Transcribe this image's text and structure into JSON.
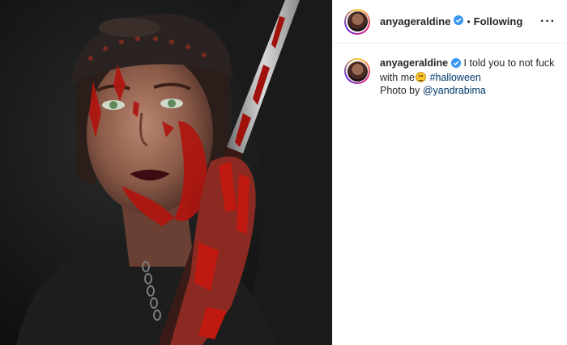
{
  "post": {
    "image_alt": "Portrait of a woman in bloody Halloween makeup wearing a studded cap, holding a blood-stained knife"
  },
  "header": {
    "username": "anyageraldine",
    "separator": "•",
    "follow_status": "Following",
    "more_label": "···"
  },
  "caption": {
    "username": "anyageraldine",
    "text_part1": " I told you to not fuck with me",
    "hashtag": "#halloween",
    "credit_prefix": "Photo by ",
    "credit_handle": "@yandrabima"
  },
  "colors": {
    "verified_badge": "#3897f0",
    "link": "#00376b",
    "text": "#262626"
  }
}
